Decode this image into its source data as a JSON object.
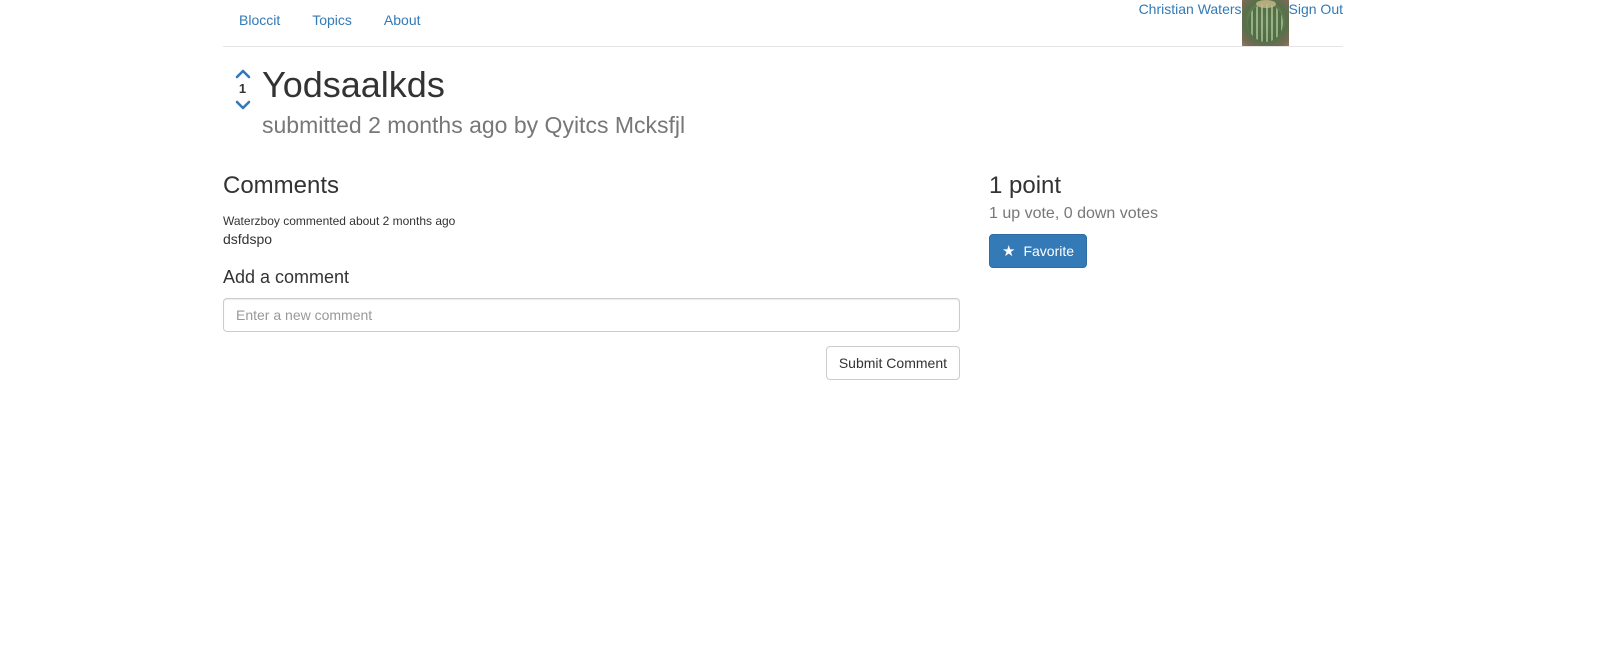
{
  "nav": {
    "links": [
      {
        "label": "Bloccit"
      },
      {
        "label": "Topics"
      },
      {
        "label": "About"
      }
    ],
    "user_name": "Christian Waters",
    "sign_out": "Sign Out"
  },
  "post": {
    "vote_count": "1",
    "title": "Yodsaalkds",
    "submitted": "submitted 2 months ago by Qyitcs Mcksfjl"
  },
  "comments": {
    "title": "Comments",
    "items": [
      {
        "meta": "Waterzboy commented about 2 months ago",
        "body": "dsfdspo"
      }
    ],
    "add_title": "Add a comment",
    "input_placeholder": "Enter a new comment",
    "submit_label": "Submit Comment"
  },
  "sidebar": {
    "points": "1 point",
    "votes_summary": "1 up vote, 0 down votes",
    "favorite_label": "Favorite",
    "favorite_icon": "star-icon"
  },
  "colors": {
    "link": "#337ab7",
    "primary": "#337ab7",
    "muted": "#777777"
  }
}
